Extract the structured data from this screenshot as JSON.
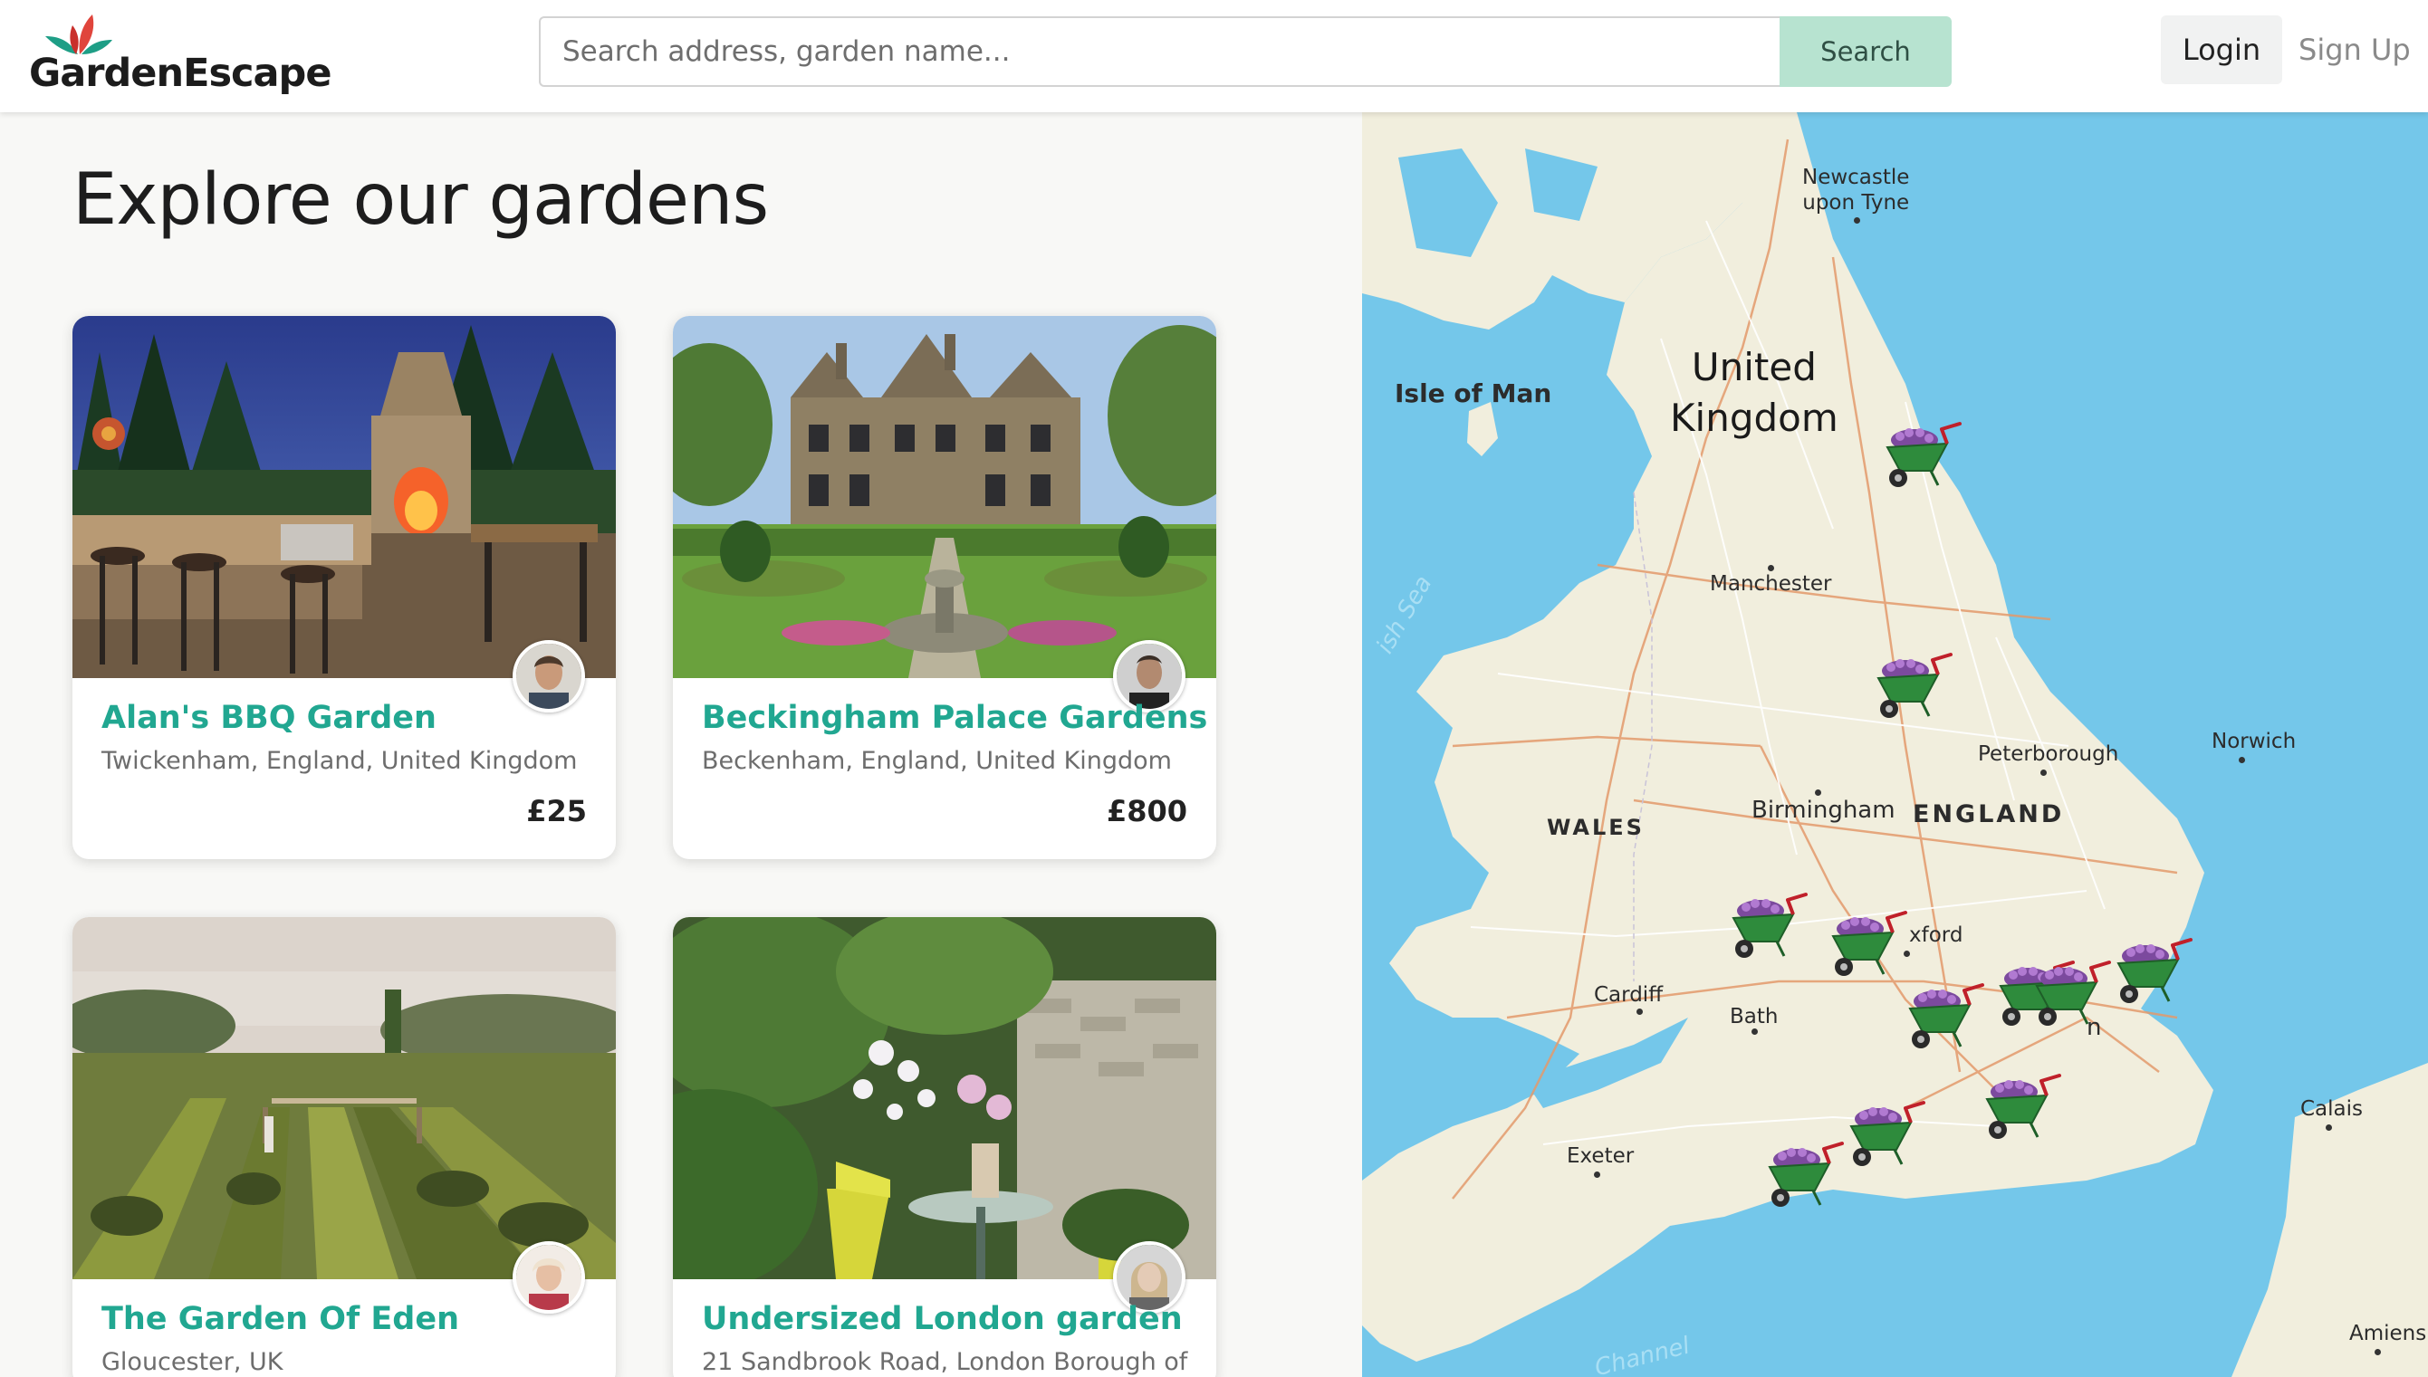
{
  "brand": {
    "name": "GardenEscape"
  },
  "search": {
    "placeholder": "Search address, garden name...",
    "button_label": "Search"
  },
  "auth": {
    "login_label": "Login",
    "signup_label": "Sign Up"
  },
  "page": {
    "title": "Explore our gardens"
  },
  "gardens": [
    {
      "name": "Alan's BBQ Garden",
      "location": "Twickenham, England, United Kingdom",
      "price": "£25"
    },
    {
      "name": "Beckingham Palace Gardens",
      "location": "Beckenham, England, United Kingdom",
      "price": "£800"
    },
    {
      "name": "The Garden Of Eden",
      "location": "Gloucester, UK",
      "price": ""
    },
    {
      "name": "Undersized London garden",
      "location": "21 Sandbrook Road, London Borough of",
      "price": ""
    }
  ],
  "map": {
    "labels": {
      "newcastle": "Newcastle\nupon Tyne",
      "isle_of_man": "Isle of Man",
      "united_kingdom": "United\nKingdom",
      "manchester": "Manchester",
      "irish_sea": "ish Sea",
      "peterborough": "Peterborough",
      "norwich": "Norwich",
      "wales": "WALES",
      "birmingham": "Birmingham",
      "england": "ENGLAND",
      "oxford": "xford",
      "cardiff": "Cardiff",
      "bath": "Bath",
      "london": "n",
      "calais": "Calais",
      "exeter": "Exeter",
      "channel": "Channel",
      "amiens": "Amiens"
    },
    "marker_icon": "wheelbarrow-flowers-icon",
    "marker_count": 11
  },
  "colors": {
    "accent": "#21a791",
    "search_button": "#b7e3d0",
    "sea": "#74c7ea",
    "land": "#f1eedd"
  }
}
